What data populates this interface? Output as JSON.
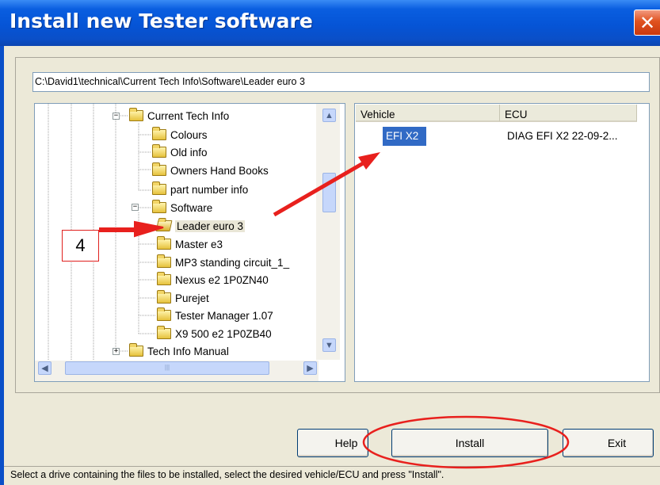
{
  "window": {
    "title": "Install new Tester software",
    "close_label": "✕"
  },
  "path_field": {
    "value": "C:\\David1\\technical\\Current Tech Info\\Software\\Leader euro 3"
  },
  "tree": {
    "items": [
      {
        "label": "Current Tech Info"
      },
      {
        "label": "Colours"
      },
      {
        "label": "Old info"
      },
      {
        "label": "Owners Hand Books"
      },
      {
        "label": "part number info"
      },
      {
        "label": "Software"
      },
      {
        "label": "Leader euro 3"
      },
      {
        "label": "Master e3"
      },
      {
        "label": "MP3 standing circuit_1_"
      },
      {
        "label": "Nexus e2 1P0ZN40"
      },
      {
        "label": "Purejet"
      },
      {
        "label": "Tester Manager 1.07"
      },
      {
        "label": "X9 500 e2 1P0ZB40"
      },
      {
        "label": "Tech Info Manual"
      }
    ],
    "selected": "Leader euro 3"
  },
  "list": {
    "columns": [
      "Vehicle",
      "ECU"
    ],
    "rows": [
      {
        "vehicle": "EFI X2",
        "ecu": "DIAG EFI X2 22-09-2..."
      }
    ]
  },
  "buttons": {
    "help": "Help",
    "install": "Install",
    "exit": "Exit"
  },
  "status": {
    "text": "Select a drive containing the files to be installed, select the desired vehicle/ECU and press \"Install\"."
  },
  "annotations": {
    "step_number": "4",
    "highlight_color": "#e8201d"
  },
  "colors": {
    "titlebar": "#0554d6",
    "selection": "#316ac5",
    "dialog_background": "#ece9d8"
  }
}
